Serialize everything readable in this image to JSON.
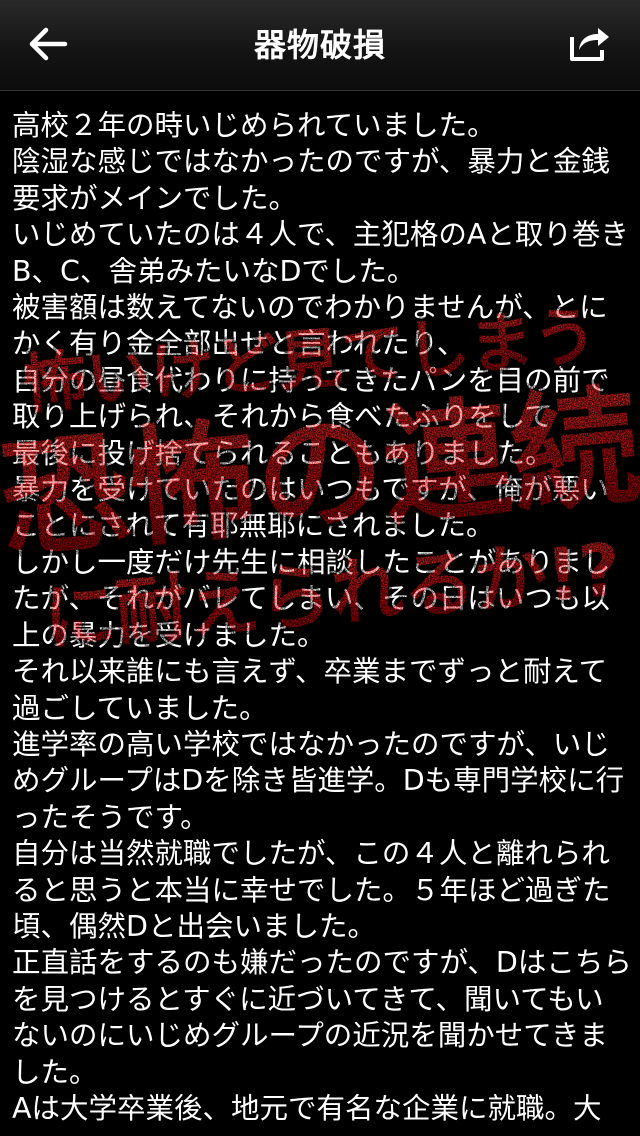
{
  "header": {
    "title": "器物破損",
    "back_icon": "back-arrow-icon",
    "share_icon": "share-icon"
  },
  "story": {
    "paragraphs": [
      "高校２年の時いじめられていました。",
      "陰湿な感じではなかったのですが、暴力と金銭要求がメインでした。",
      "いじめていたのは４人で、主犯格のAと取り巻きB、C、舎弟みたいなDでした。",
      "被害額は数えてないのでわかりませんが、とにかく有り金全部出せと言われたり、",
      "自分の昼食代わりに持ってきたパンを目の前で取り上げられ、それから食べたふりをして",
      "最後に投げ捨てられることもありました。",
      "暴力を受けていたのはいつもですが、俺が悪いことにされて有耶無耶にされました。",
      "しかし一度だけ先生に相談したことがありましたが、それがバレてしまい、その日はいつも以上の暴力を受けました。",
      "それ以来誰にも言えず、卒業までずっと耐えて過ごしていました。",
      "進学率の高い学校ではなかったのですが、いじめグループはDを除き皆進学。Dも専門学校に行ったそうです。",
      "自分は当然就職でしたが、この４人と離れられると思うと本当に幸せでした。５年ほど過ぎた頃、偶然Dと出会いました。",
      "正直話をするのも嫌だったのですが、Dはこちらを見つけるとすぐに近づいてきて、聞いてもいないのにいじめグループの近況を聞かせてきました。",
      "Aは大学卒業後、地元で有名な企業に就職。大"
    ]
  },
  "promo": {
    "line1": "怖いけど見てしまう",
    "line2": "恐怖の連続",
    "line3": "に耐えられるか!?",
    "color_main": "#e8121c",
    "color_dark": "#7a0000"
  }
}
